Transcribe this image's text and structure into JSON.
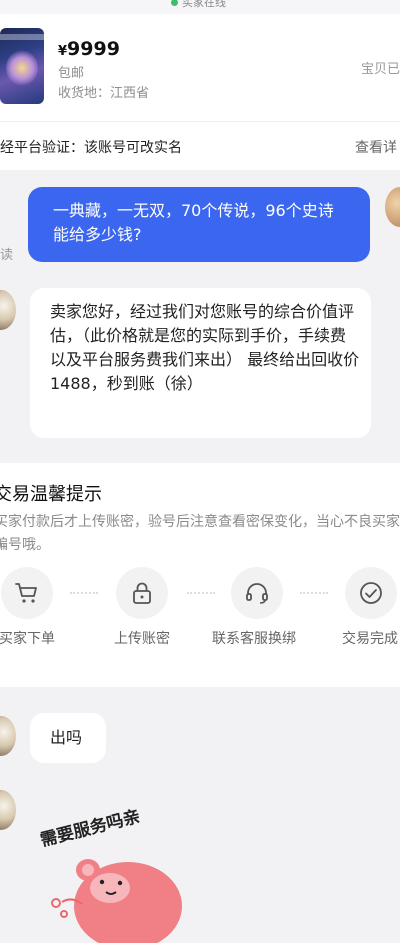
{
  "status": {
    "text": "买家在线",
    "color": "#3dbf6a"
  },
  "product": {
    "price_symbol": "¥",
    "price": "9999",
    "shipping": "包邮",
    "location": "收货地：江西省",
    "right_text": "宝贝已"
  },
  "verify": {
    "text": "经平台验证：该账号可改实名",
    "link": "查看详"
  },
  "chat": {
    "read_label": "读",
    "my_message": "一典藏，一无双，70个传说，96个史诗 能给多少钱?",
    "seller_message": "卖家您好，经过我们对您账号的综合价值评估，（此价格就是您的实际到手价，手续费以及平台服务费我们来出） 最终给出回收价1488，秒到账（徐）",
    "followup_message": "出吗"
  },
  "tips": {
    "title": "交易温馨提示",
    "desc": "买家付款后才上传账密，验号后注意查看密保变化，当心不良买家骗号哦。",
    "steps": [
      {
        "label": "买家下单",
        "icon": "cart-icon"
      },
      {
        "label": "上传账密",
        "icon": "lock-icon"
      },
      {
        "label": "联系客服换绑",
        "icon": "headset-icon"
      },
      {
        "label": "交易完成",
        "icon": "check-circle-icon"
      }
    ]
  },
  "sticker": {
    "text": "需要服务吗亲"
  },
  "colors": {
    "accent": "#3a66f0",
    "background": "#f2f2f4"
  }
}
